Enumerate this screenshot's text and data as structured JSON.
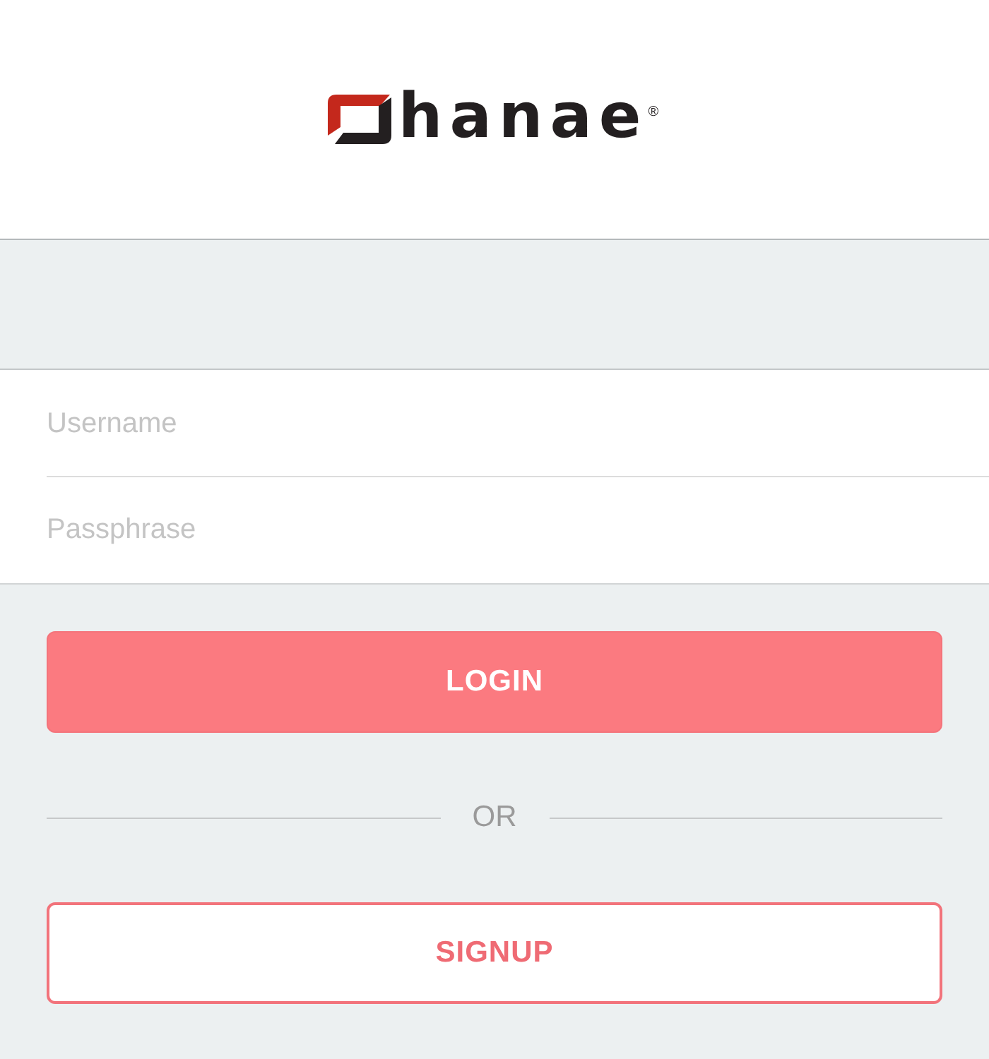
{
  "header": {
    "logo": {
      "wordmark": "hanae",
      "registered": "®"
    }
  },
  "fields": [
    {
      "placeholder": "Username"
    },
    {
      "placeholder": "Passphrase"
    }
  ],
  "buttons": [
    {
      "label": "LOGIN",
      "kind": "primary"
    },
    {
      "label": "SIGNUP",
      "kind": "outline"
    }
  ],
  "separator": {
    "label": "OR"
  }
}
